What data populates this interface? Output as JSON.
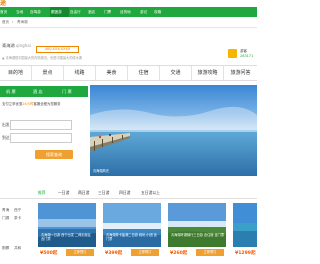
{
  "header": {
    "logo_text": "途"
  },
  "nav": {
    "items": [
      {
        "label": "首页"
      },
      {
        "label": "当地"
      },
      {
        "label": "自驾游"
      },
      {
        "label": "跟团游"
      },
      {
        "label": "自由行"
      },
      {
        "label": "酒店"
      },
      {
        "label": "门票"
      },
      {
        "label": "目的地"
      },
      {
        "label": "游记"
      },
      {
        "label": "攻略"
      }
    ]
  },
  "crumbs": {
    "home": "首页",
    "current": "青海湖"
  },
  "title": {
    "name": "青海湖",
    "pinyin": "qinghai"
  },
  "phone_badge": "400-XXX-XXXX",
  "user": {
    "name": "游客",
    "id": "283171"
  },
  "info_line": "▲ 青海湖是中国最大的内陆湖泊，也是中国最大的咸水湖",
  "tabs": [
    "目的地",
    "景点",
    "线路",
    "美食",
    "住宿",
    "交通",
    "旅游攻略",
    "旅游问答"
  ],
  "search_panel": {
    "head_left": "机 票",
    "head_mid": "酒 店",
    "head_right": "门 票",
    "line1_prefix": "支付立享优惠",
    "line1_highlight": "24小时",
    "line1_suffix": "客服全程为您服务",
    "field1_label": "出发",
    "field2_label": "到达",
    "field3_label": "日期",
    "button": "搜索查询"
  },
  "photo": {
    "caption": "青海湖风光"
  },
  "filter_tabs": [
    "推荐",
    "一日游",
    "两日游",
    "三日游",
    "四日游",
    "五日游以上"
  ],
  "side": [
    "青海",
    "西宁",
    "门源",
    "茶卡",
    "刚察",
    "共和"
  ],
  "cards": [
    {
      "title": "青海湖一日游 西宁出发 二郎剑景区 含门票",
      "price": "¥500起",
      "btn": "立即预订"
    },
    {
      "title": "青海湖茶卡盐湖二日游 纯玩 小团 含门票",
      "price": "¥399起",
      "btn": "立即预订"
    },
    {
      "title": "青海湖环湖骑行三日游 含住宿 含门票",
      "price": "¥260起",
      "btn": "立即预订"
    },
    {
      "title": "青海湖经典四日游 大环线 含门票",
      "price": "¥1299起",
      "btn": "立即预订"
    }
  ],
  "colors": {
    "brand_green": "#1fa83d",
    "accent_orange": "#f08300",
    "price_orange": "#f55a00"
  }
}
